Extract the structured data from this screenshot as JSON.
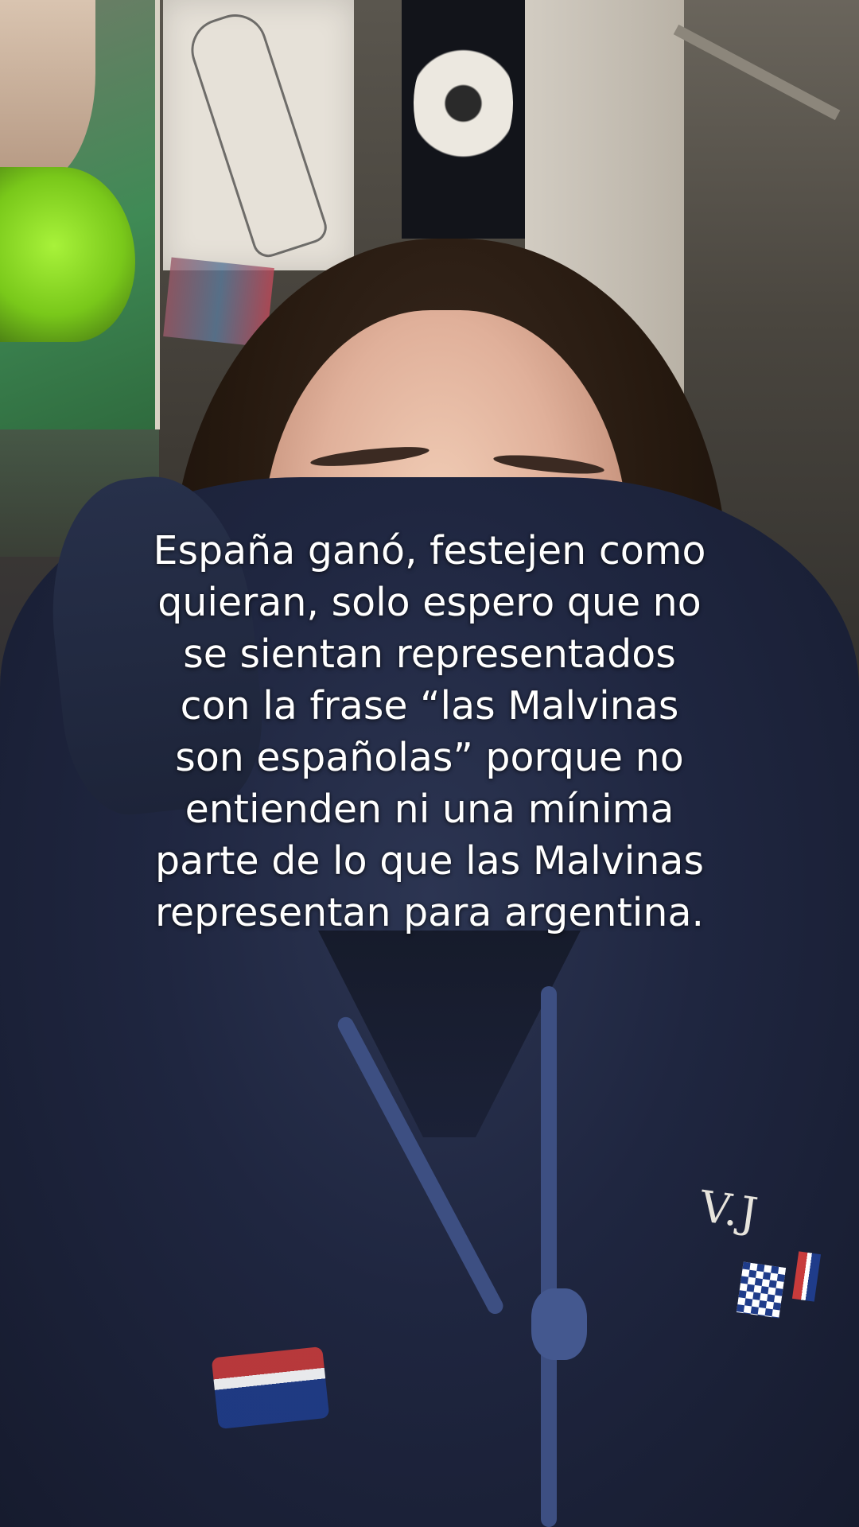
{
  "caption": {
    "lines": [
      "España ganó, festejen como",
      "quieran, solo espero que no",
      "se sientan representados",
      "con la frase “las Malvinas",
      "son españolas” porque no",
      "entienden ni una mínima",
      "parte de lo que las Malvinas",
      "representan para argentina."
    ]
  },
  "sweatshirt": {
    "embroidery_text": "V.J"
  },
  "colors": {
    "caption_text": "#ffffff",
    "hoodie_navy": "#1f2640",
    "drawstring_blue": "#3d4f82"
  }
}
